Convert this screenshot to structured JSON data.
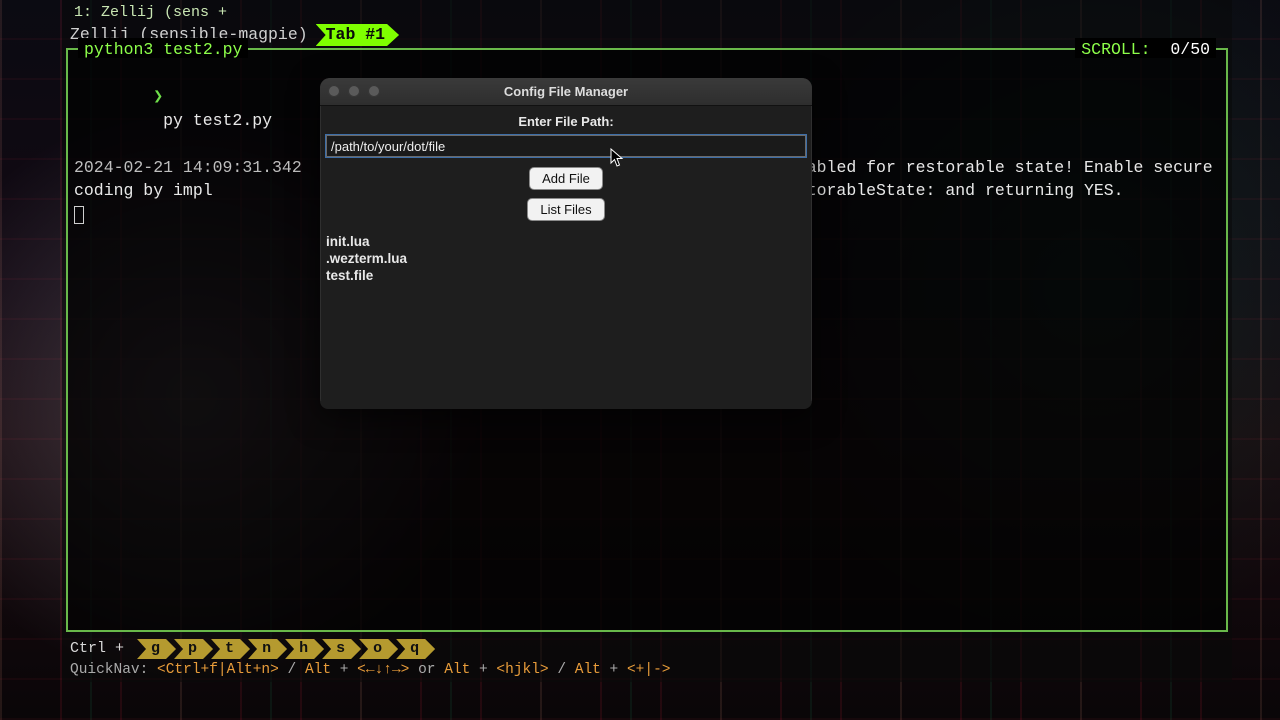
{
  "os_title": "1: Zellij (sens +",
  "zellij": {
    "label": "Zellij (sensible-magpie)",
    "tab": "Tab #1"
  },
  "pane": {
    "title": "python3 test2.py",
    "scroll_label": "SCROLL:",
    "scroll_value": "0/50"
  },
  "terminal": {
    "prompt": "❯",
    "command": "py test2.py",
    "timestamp": "2024-02-21 14:09:31.342",
    "msg_rest": "ot enabled for restorable state! Enable secure coding by impl                                                rtsSecureRestorableState: and returning YES."
  },
  "dialog": {
    "title": "Config File Manager",
    "label": "Enter File Path:",
    "input_value": "/path/to/your/dot/file",
    "add_btn": "Add File",
    "list_btn": "List Files",
    "files": [
      "init.lua",
      ".wezterm.lua",
      "test.file"
    ]
  },
  "hotkeys": {
    "prefix": "Ctrl + ",
    "keys": [
      "g",
      "p",
      "t",
      "n",
      "h",
      "s",
      "o",
      "q"
    ]
  },
  "quicknav": {
    "prefix": "QuickNav: ",
    "seg1": "<Ctrl+f|Alt+n>",
    "mid1": " / ",
    "alt": "Alt",
    "plus": " + ",
    "seg2": "<←↓↑→>",
    "or": " or ",
    "seg3": "<hjkl>",
    "seg4": "<+|->"
  }
}
